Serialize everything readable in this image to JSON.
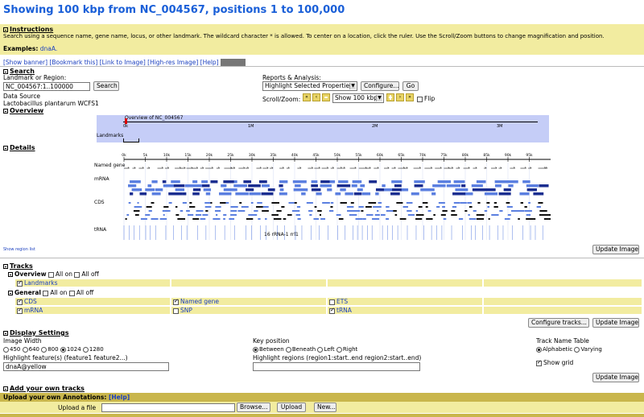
{
  "page_title": "Showing 100 kbp from NC_004567, positions 1 to 100,000",
  "instructions": {
    "heading": "Instructions",
    "text": "Search using a sequence name, gene name, locus, or other landmark. The wildcard character * is allowed. To center on a location, click the ruler. Use the Scroll/Zoom buttons to change magnification and position.",
    "examples_label": "Examples:",
    "examples_link": "dnaA."
  },
  "top_links": [
    "[Show banner]",
    "[Bookmark this]",
    "[Link to Image]",
    "[High-res Image]",
    "[Help]",
    "[Reset]"
  ],
  "search": {
    "heading": "Search",
    "landmark_label": "Landmark or Region:",
    "landmark_value": "NC_004567:1..100000",
    "search_button": "Search",
    "data_source_label": "Data Source",
    "data_source_value": "Lactobacillus plantarum WCFS1"
  },
  "reports": {
    "label": "Reports & Analysis:",
    "selected": "Highlight Selected Properties",
    "configure_button": "Configure...",
    "go_button": "Go",
    "scroll_label": "Scroll/Zoom:",
    "zoom_value": "Show 100 kbp",
    "flip_label": "Flip"
  },
  "overview": {
    "heading": "Overview",
    "chrom_label": "Overview of NC_004567",
    "ticks": [
      "0k",
      "1M",
      "2M",
      "3M"
    ],
    "landmarks_label": "Landmarks"
  },
  "details": {
    "heading": "Details",
    "ticks": [
      "0k",
      "5k",
      "10k",
      "15k",
      "20k",
      "25k",
      "30k",
      "35k",
      "40k",
      "45k",
      "50k",
      "55k",
      "60k",
      "65k",
      "70k",
      "75k",
      "80k",
      "85k",
      "90k",
      "95k"
    ],
    "track_labels": [
      "Named gene",
      "mRNA",
      "CDS",
      "tRNA"
    ],
    "annotation": "16 rRNA-1 rrl1",
    "small_link": "Show region list",
    "update_button": "Update Image"
  },
  "tracks": {
    "heading": "Tracks",
    "overview_group": "Overview",
    "all_on": "All on",
    "all_off": "All off",
    "overview_items": [
      {
        "label": "Landmarks",
        "checked": true
      }
    ],
    "general_group": "General",
    "general_items": [
      {
        "label": "CDS",
        "checked": true
      },
      {
        "label": "Named gene",
        "checked": true
      },
      {
        "label": "ETS",
        "checked": false
      },
      {
        "label": "mRNA",
        "checked": true
      },
      {
        "label": "SNP",
        "checked": false
      },
      {
        "label": "tRNA",
        "checked": true
      }
    ],
    "configure_button": "Configure tracks...",
    "update_button": "Update Image"
  },
  "display": {
    "heading": "Display Settings",
    "image_width_label": "Image Width",
    "widths": [
      {
        "label": "450",
        "on": false
      },
      {
        "label": "640",
        "on": false
      },
      {
        "label": "800",
        "on": false
      },
      {
        "label": "1024",
        "on": true
      },
      {
        "label": "1280",
        "on": false
      }
    ],
    "highlight_features_label": "Highlight feature(s) (feature1 feature2...)",
    "highlight_features_value": "dnaA@yellow",
    "key_position_label": "Key position",
    "key_positions": [
      {
        "label": "Between",
        "on": true
      },
      {
        "label": "Beneath",
        "on": false
      },
      {
        "label": "Left",
        "on": false
      },
      {
        "label": "Right",
        "on": false
      }
    ],
    "highlight_regions_label": "Highlight regions (region1:start..end region2:start..end)",
    "highlight_regions_value": "",
    "track_name_label": "Track Name Table",
    "track_name_options": [
      {
        "label": "Alphabetic",
        "on": true
      },
      {
        "label": "Varying",
        "on": false
      }
    ],
    "show_grid_label": "Show grid",
    "update_button": "Update Image"
  },
  "own_tracks": {
    "heading": "Add your own tracks",
    "upload_title": "Upload your own Annotations:",
    "upload_help": "[Help]",
    "upload_label": "Upload a file",
    "browse_button": "Browse...",
    "upload_button": "Upload",
    "new_button": "New..."
  },
  "colors": {
    "title": "#1a5fd8",
    "panel": "#f2eca0",
    "overview_bg": "#c5cdf7",
    "feature": "#5b7fe0",
    "feature_dark": "#1b2e90"
  }
}
